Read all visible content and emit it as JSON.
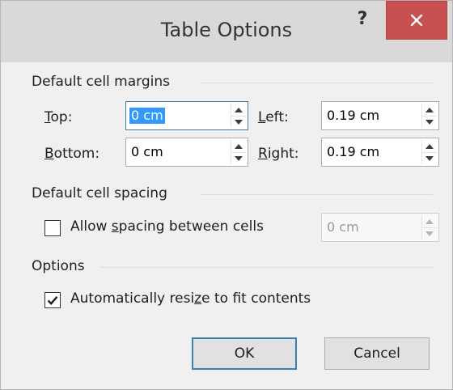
{
  "dialog": {
    "title": "Table Options",
    "help_label": "?"
  },
  "margins": {
    "heading": "Default cell margins",
    "top": {
      "label_key": "T",
      "label_rest": "op:",
      "value": "0 cm"
    },
    "bottom": {
      "label_key": "B",
      "label_rest": "ottom:",
      "value": "0 cm"
    },
    "left": {
      "label_key": "L",
      "label_rest": "eft:",
      "value": "0.19 cm"
    },
    "right": {
      "label_key": "R",
      "label_rest": "ight:",
      "value": "0.19 cm"
    }
  },
  "spacing": {
    "heading": "Default cell spacing",
    "allow_label_pre": "Allow ",
    "allow_label_key": "s",
    "allow_label_post": "pacing between cells",
    "allow_checked": false,
    "value": "0 cm"
  },
  "options": {
    "heading": "Options",
    "autoresize_label_pre": "Automatically resi",
    "autoresize_label_key": "z",
    "autoresize_label_post": "e to fit contents",
    "autoresize_checked": true
  },
  "buttons": {
    "ok": "OK",
    "cancel": "Cancel"
  },
  "colors": {
    "close_button": "#c75050",
    "focus_border": "#3c7fb1",
    "selection": "#3399ff"
  }
}
